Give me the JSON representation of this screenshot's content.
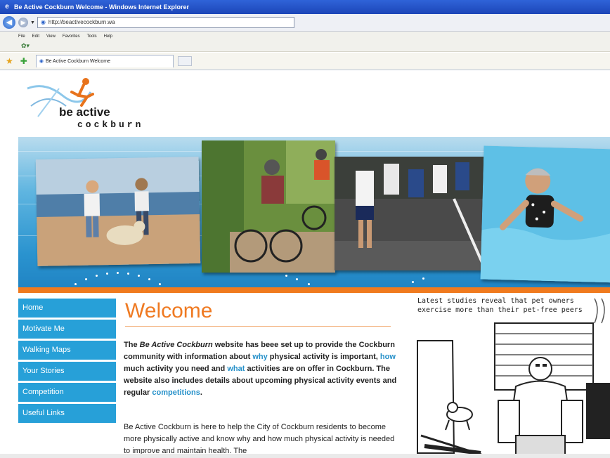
{
  "window": {
    "title": "Be Active Cockburn Welcome - Windows Internet Explorer"
  },
  "address": {
    "url": "http://beactivecockburn.wa"
  },
  "menu": [
    "File",
    "Edit",
    "View",
    "Favorites",
    "Tools",
    "Help"
  ],
  "tab": {
    "label": "Be Active Cockburn Welcome"
  },
  "logo": {
    "line1": "be active",
    "line2": "cockburn"
  },
  "nav": [
    "Home",
    "Motivate Me",
    "Walking Maps",
    "Your Stories",
    "Competition",
    "Useful Links"
  ],
  "content": {
    "heading": "Welcome",
    "intro": {
      "part1": "The ",
      "site_name": "Be Active Cockburn",
      "part2": " website has beee set up to provide the Cockburn community with information about ",
      "link_why": "why",
      "part3": " physical activity is important, ",
      "link_how": "how",
      "part4": " much activity you need and ",
      "link_what": "what",
      "part5": " activities are on offer in Cockburn. The website also includes details about upcoming physical activity events and regular ",
      "link_competitions": "competitions",
      "part6": "."
    },
    "para2": "Be Active Cockburn is here to help the City of Cockburn residents to become more physically active and know why and how much physical activity is needed to improve and maintain health. The"
  },
  "cartoon": {
    "caption": "Latest studies reveal that pet owners exercise more than their pet-free peers"
  },
  "colors": {
    "accent_orange": "#f07a1e",
    "nav_blue": "#27a0d8",
    "heading_orange": "#ef7a22",
    "link_blue": "#2590c9"
  }
}
